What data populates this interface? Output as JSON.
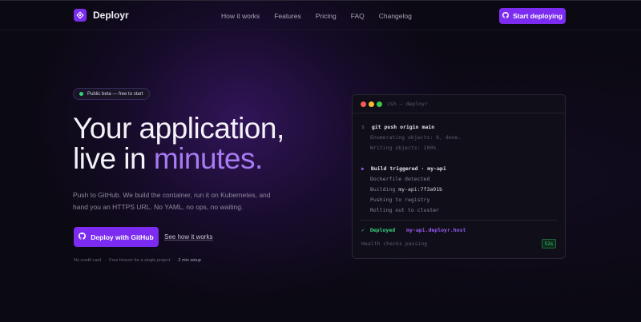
{
  "nav": {
    "brand": "Deployr",
    "links": [
      "How it works",
      "Features",
      "Pricing",
      "FAQ",
      "Changelog"
    ],
    "cta": "Start deploying"
  },
  "hero": {
    "badge": "Public beta — free to start",
    "headline_line1": "Your application,",
    "headline_line2_prefix": "live in ",
    "headline_line2_accent": "minutes.",
    "subtext": "Push to GitHub. We build the container, run it on Kubernetes, and hand you an HTTPS URL. No YAML, no ops, no waiting.",
    "primary_cta": "Deploy with GitHub",
    "secondary_cta": "See how it works",
    "fineprint": [
      "No credit card",
      "Free forever for a single project",
      "2 min setup"
    ]
  },
  "terminal": {
    "title": "zsh — deployr",
    "lines": {
      "prompt": "$",
      "command": "git push origin main",
      "enum": "Enumerating objects: 8, done.",
      "writing": "Writing objects: 100%",
      "build_marker": "▶",
      "build_label": "Build triggered · my-api",
      "dockerfile": "Dockerfile detected",
      "building_prefix": "Building ",
      "building_tag": "my-api:7f3a91b",
      "pushing": "Pushing to registry",
      "rolling": "Rolling out to cluster",
      "check": "✓",
      "deployed": "Deployed",
      "url": "my-api.deployr.host",
      "health": "Health checks passing",
      "timer": "52s"
    }
  },
  "colors": {
    "accent": "#7b2cf0",
    "accent_text": "#a77bf3",
    "success": "#3ad27d",
    "background": "#0b0912"
  },
  "icons": {
    "logo": "deployr-logo-icon",
    "github": "github-icon"
  }
}
